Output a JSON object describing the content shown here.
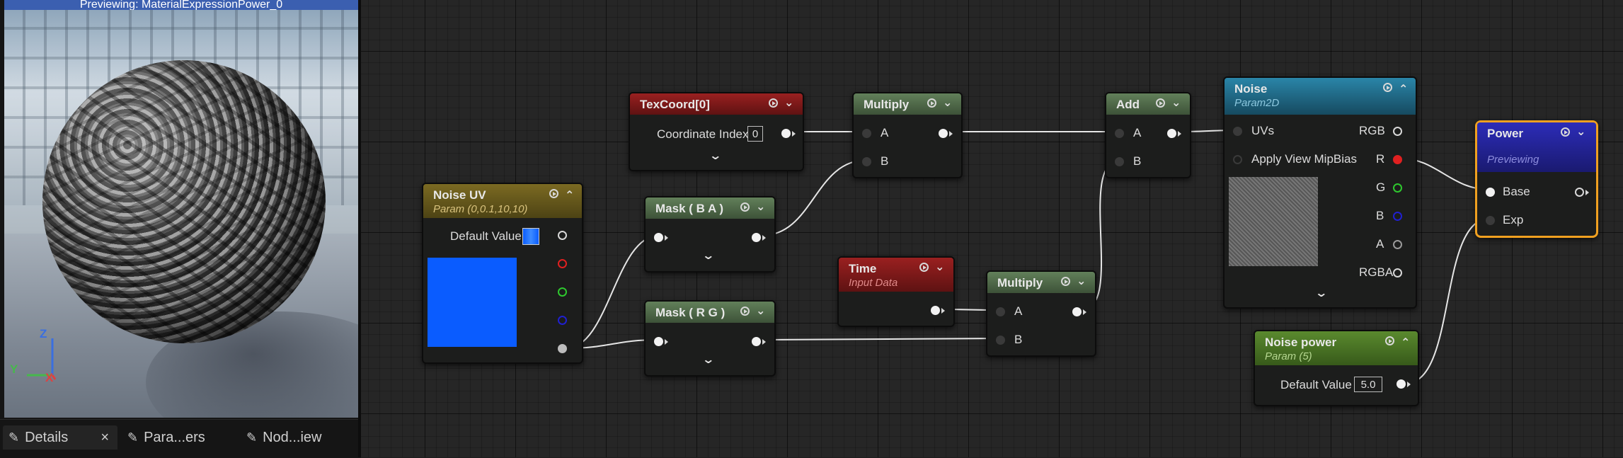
{
  "preview": {
    "header": "Previewing: MaterialExpressionPower_0",
    "axis": {
      "z": "Z",
      "y": "Y",
      "x": "X"
    }
  },
  "tabs": [
    {
      "label": "Details",
      "icon": "pencil-icon",
      "closable": true
    },
    {
      "label": "Para...ers",
      "icon": "pencil-icon"
    },
    {
      "label": "Nod...iew",
      "icon": "pencil-icon"
    }
  ],
  "tabs_close_glyph": "×",
  "colors": {
    "graph_bg": "#262626",
    "header_red": "#8a1d1d",
    "header_green": "#4c6a44",
    "header_olive": "#6d5e1f",
    "header_blue": "#1f6f8f",
    "header_power": "#2828a6",
    "header_lime": "#5a8a2e",
    "selection_outline": "#f0a020",
    "pin_red": "#e02020",
    "pin_green": "#2ec82e",
    "pin_blue": "#2020d0"
  },
  "nodes": {
    "noise_uv": {
      "title": "Noise UV",
      "subtitle": "Param (0,0.1,10,10)",
      "row_label": "Default Value",
      "swatch_color": "#0a5cff"
    },
    "texcoord": {
      "title": "TexCoord[0]",
      "row_label": "Coordinate Index",
      "value": "0"
    },
    "mask_ba": {
      "title": "Mask ( B A )"
    },
    "mask_rg": {
      "title": "Mask ( R G )"
    },
    "multiply_1": {
      "title": "Multiply",
      "pin_a": "A",
      "pin_b": "B"
    },
    "time": {
      "title": "Time",
      "subtitle": "Input Data"
    },
    "multiply_2": {
      "title": "Multiply",
      "pin_a": "A",
      "pin_b": "B"
    },
    "add": {
      "title": "Add",
      "pin_a": "A",
      "pin_b": "B"
    },
    "noise": {
      "title": "Noise",
      "subtitle": "Param2D",
      "inputs": [
        "UVs",
        "Apply View MipBias"
      ],
      "outputs": [
        "RGB",
        "R",
        "G",
        "B",
        "A",
        "RGBA"
      ]
    },
    "noise_power": {
      "title": "Noise power",
      "subtitle": "Param (5)",
      "row_label": "Default Value",
      "value": "5.0"
    },
    "power": {
      "title": "Power",
      "subtitle": "Previewing",
      "pin_base": "Base",
      "pin_exp": "Exp"
    }
  },
  "glyphs": {
    "chevron_down": "⌄",
    "chevron_up": "⌃",
    "expand": "⌄"
  }
}
